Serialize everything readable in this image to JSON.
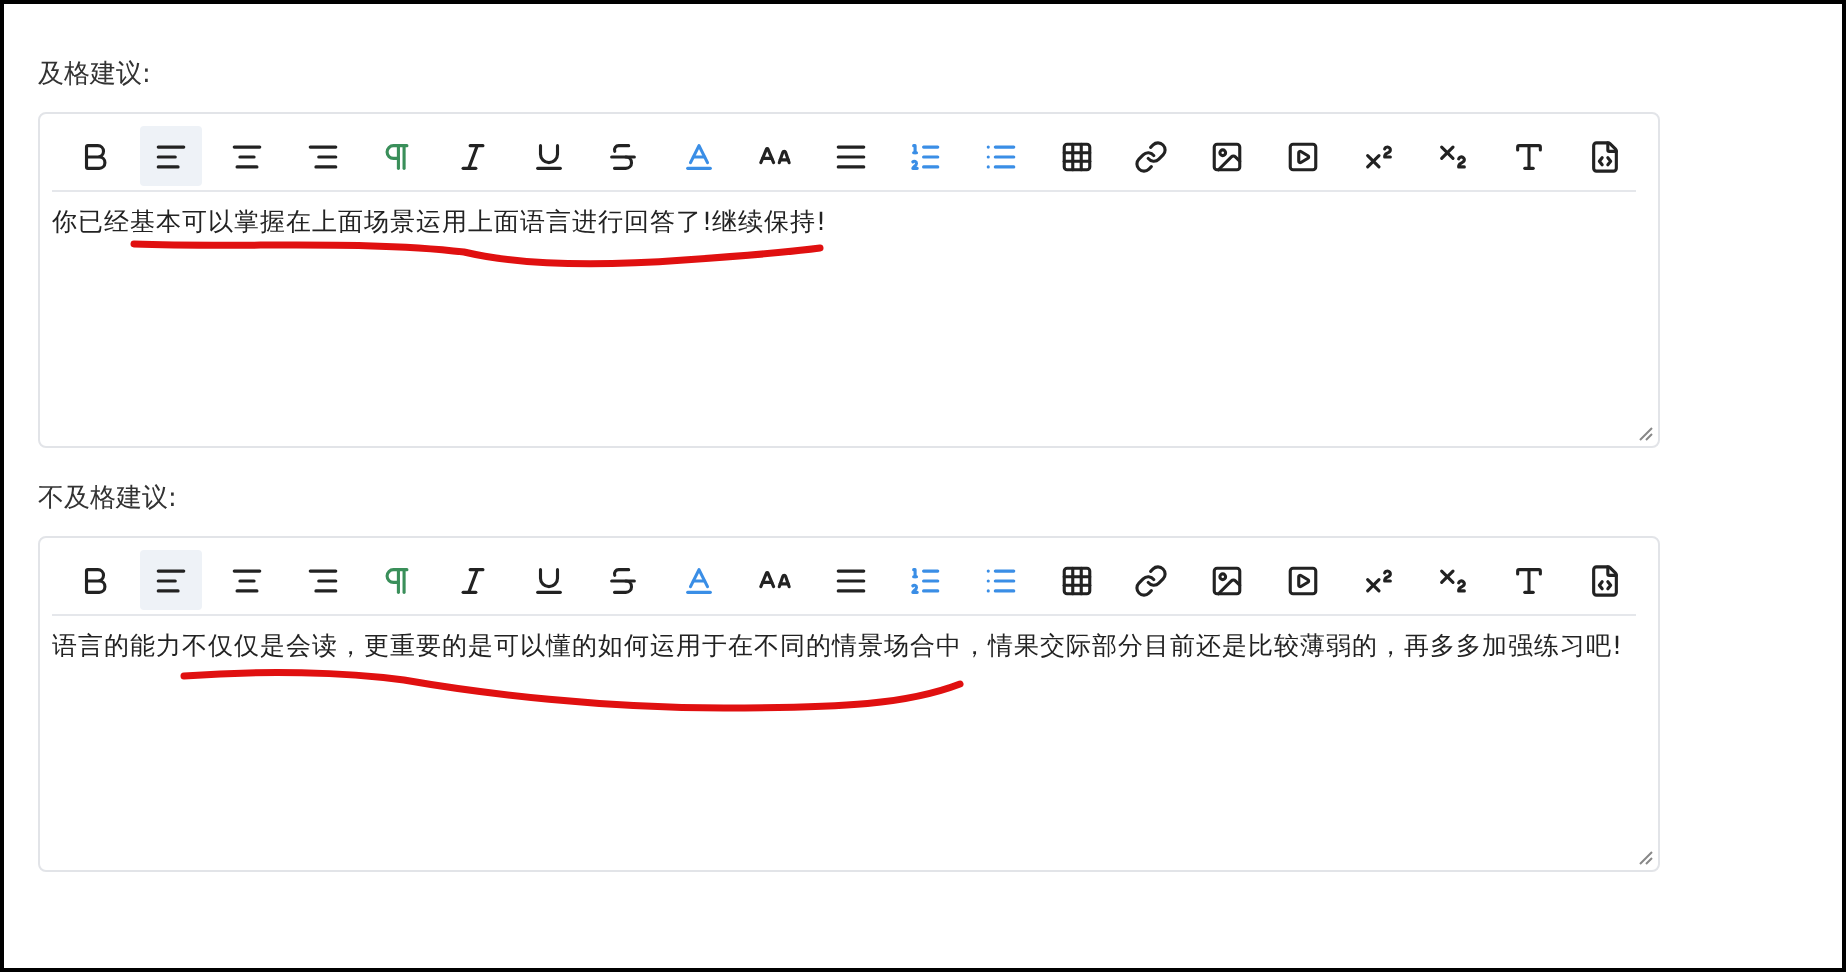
{
  "editors": [
    {
      "label": "及格建议:",
      "toolbar": [
        {
          "kind": "bold",
          "selected": false
        },
        {
          "kind": "align-left",
          "selected": true
        },
        {
          "kind": "align-center",
          "selected": false
        },
        {
          "kind": "align-right",
          "selected": false
        },
        {
          "kind": "paragraph",
          "selected": false
        },
        {
          "kind": "italic",
          "selected": false
        },
        {
          "kind": "underline",
          "selected": false
        },
        {
          "kind": "strike",
          "selected": false
        },
        {
          "kind": "font-color",
          "selected": false
        },
        {
          "kind": "font-size",
          "selected": false
        },
        {
          "kind": "justify",
          "selected": false
        },
        {
          "kind": "ordered-list",
          "selected": false
        },
        {
          "kind": "bullet-list",
          "selected": false
        },
        {
          "kind": "table",
          "selected": false
        },
        {
          "kind": "link",
          "selected": false
        },
        {
          "kind": "image",
          "selected": false
        },
        {
          "kind": "video",
          "selected": false
        },
        {
          "kind": "superscript",
          "selected": false
        },
        {
          "kind": "subscript",
          "selected": false
        },
        {
          "kind": "text-box",
          "selected": false
        },
        {
          "kind": "source",
          "selected": false
        }
      ],
      "value": "你已经基本可以掌握在上面场景运用上面语言进行回答了!继续保持!"
    },
    {
      "label": "不及格建议:",
      "toolbar": [
        {
          "kind": "bold",
          "selected": false
        },
        {
          "kind": "align-left",
          "selected": true
        },
        {
          "kind": "align-center",
          "selected": false
        },
        {
          "kind": "align-right",
          "selected": false
        },
        {
          "kind": "paragraph",
          "selected": false
        },
        {
          "kind": "italic",
          "selected": false
        },
        {
          "kind": "underline",
          "selected": false
        },
        {
          "kind": "strike",
          "selected": false
        },
        {
          "kind": "font-color",
          "selected": false
        },
        {
          "kind": "font-size",
          "selected": false
        },
        {
          "kind": "justify",
          "selected": false
        },
        {
          "kind": "ordered-list",
          "selected": false
        },
        {
          "kind": "bullet-list",
          "selected": false
        },
        {
          "kind": "table",
          "selected": false
        },
        {
          "kind": "link",
          "selected": false
        },
        {
          "kind": "image",
          "selected": false
        },
        {
          "kind": "video",
          "selected": false
        },
        {
          "kind": "superscript",
          "selected": false
        },
        {
          "kind": "subscript",
          "selected": false
        },
        {
          "kind": "text-box",
          "selected": false
        },
        {
          "kind": "source",
          "selected": false
        }
      ],
      "value": "语言的能力不仅仅是会读，更重要的是可以懂的如何运用于在不同的情景场合中，情果交际部分目前还是比较薄弱的，再多多加强练习吧!"
    }
  ]
}
